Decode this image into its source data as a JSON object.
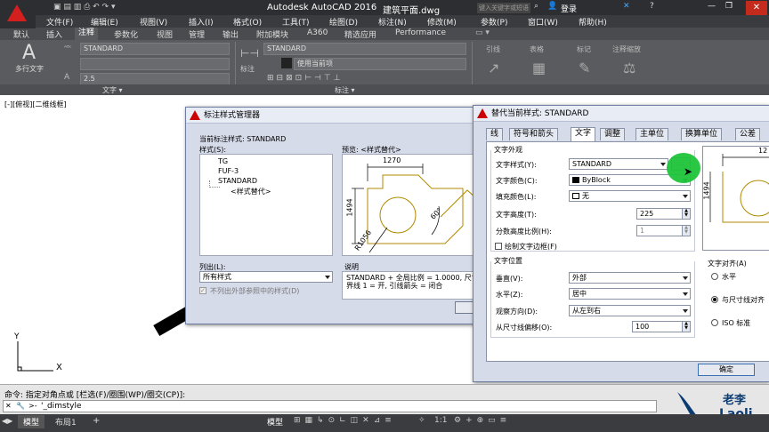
{
  "title": {
    "app": "Autodesk AutoCAD 2016",
    "file": "建筑平面.dwg",
    "search_placeholder": "键入关键字或短语",
    "login": "登录"
  },
  "menu": [
    "文件(F)",
    "编辑(E)",
    "视图(V)",
    "插入(I)",
    "格式(O)",
    "工具(T)",
    "绘图(D)",
    "标注(N)",
    "修改(M)",
    "参数(P)",
    "窗口(W)",
    "帮助(H)"
  ],
  "ribbon_tabs": [
    "默认",
    "插入",
    "注释",
    "参数化",
    "视图",
    "管理",
    "输出",
    "附加模块",
    "A360",
    "精选应用",
    "Performance"
  ],
  "ribbon": {
    "mtext": "多行文字",
    "text_style": "STANDARD",
    "text_height": "2.5",
    "text_group": "文字 ▾",
    "dim_label": "标注",
    "dim_style": "STANDARD",
    "dim_layer": "使用当前项",
    "dim_group": "标注 ▾",
    "groups": [
      "引线",
      "表格",
      "标记",
      "注释缩放"
    ]
  },
  "viewport_label": "[-][俯视][二维线框]",
  "dim_manager": {
    "title": "标注样式管理器",
    "current_style": "当前标注样式: STANDARD",
    "styles_label": "样式(S):",
    "styles": [
      "TG",
      "FUF-3",
      "STANDARD",
      "<样式替代>"
    ],
    "preview_label": "预览: <样式替代>",
    "list_label": "列出(L):",
    "list_value": "所有样式",
    "checkbox": "不列出外部参照中的样式(D)",
    "desc_label": "说明",
    "desc": "STANDARD + 全局比例 = 1.0000, 尺寸界线 1 = 开, 引线箭头 = 闭合",
    "preview_dims": {
      "top": "1270",
      "left": "1494",
      "angle": "60°",
      "radius": "R1056"
    }
  },
  "override_dlg": {
    "title": "替代当前样式: STANDARD",
    "tabs": [
      "线",
      "符号和箭头",
      "文字",
      "调整",
      "主单位",
      "换算单位",
      "公差"
    ],
    "appearance": "文字外观",
    "style_label": "文字样式(Y):",
    "style_value": "STANDARD",
    "color_label": "文字颜色(C):",
    "color_value": "ByBlock",
    "fill_label": "填充颜色(L):",
    "fill_value": "无",
    "height_label": "文字高度(T):",
    "height_value": "225",
    "frac_label": "分数高度比例(H):",
    "frac_value": "1",
    "frame_label": "绘制文字边框(F)",
    "placement": "文字位置",
    "vert_label": "垂直(V):",
    "vert_value": "外部",
    "horiz_label": "水平(Z):",
    "horiz_value": "居中",
    "dir_label": "观察方向(D):",
    "dir_value": "从左到右",
    "offset_label": "从尺寸线偏移(O):",
    "offset_value": "100",
    "align": "文字对齐(A)",
    "align_opts": [
      "水平",
      "与尺寸线对齐",
      "ISO 标准"
    ],
    "ok": "确定",
    "preview_dims": {
      "top": "12",
      "left": "1494"
    }
  },
  "command": {
    "history": "命令: 指定对角点或 [栏选(F)/圈围(WP)/圈交(CP)]:",
    "current": "'_dimstyle"
  },
  "status": {
    "tabs": [
      "模型",
      "布局1"
    ],
    "model": "模型",
    "scale": "1:1"
  },
  "watermark": {
    "cn": "老李",
    "en": "Laoli"
  },
  "ucs": {
    "x": "X",
    "y": "Y"
  }
}
